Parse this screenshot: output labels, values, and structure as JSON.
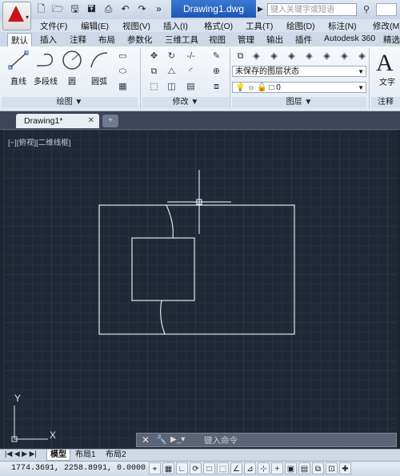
{
  "titlebar": {
    "doc_title": "Drawing1.dwg",
    "search_placeholder": "键入关键字或短语",
    "quick_access_icons": [
      "new-icon",
      "open-icon",
      "save-icon",
      "save-as-icon",
      "print-icon",
      "undo-icon",
      "redo-icon",
      "more-icon"
    ]
  },
  "menu": {
    "items": [
      "文件(F)",
      "编辑(E)",
      "视图(V)",
      "插入(I)",
      "格式(O)",
      "工具(T)",
      "绘图(D)",
      "标注(N)",
      "修改(M)"
    ]
  },
  "ribbon_tabs": {
    "items": [
      "默认",
      "插入",
      "注释",
      "布局",
      "参数化",
      "三维工具",
      "视图",
      "管理",
      "输出",
      "插件",
      "Autodesk 360",
      "精选"
    ],
    "active": "默认"
  },
  "ribbon": {
    "draw_tools": [
      "直线",
      "多段线",
      "圆",
      "圆弧"
    ],
    "draw_panel": "绘图 ▼",
    "modify_panel": "修改 ▼",
    "layer_panel": "图层 ▼",
    "annotation_panel": "注释",
    "layer_state": "未保存的图层状态",
    "current_layer": "0",
    "text_icon_glyph": "A",
    "text_label": "文字"
  },
  "file_tabs": {
    "active": "Drawing1*",
    "close": "✕"
  },
  "viewport": {
    "label": "[−][俯视][二维线框]",
    "ucs_y": "Y",
    "ucs_x": "X"
  },
  "command_line": {
    "placeholder": "键入命令",
    "close": "✕",
    "prompt_glyph": "▶_▾"
  },
  "layout_tabs": {
    "items": [
      "模型",
      "布局1",
      "布局2"
    ],
    "active": "模型",
    "nav": "|◀ ◀ ▶ ▶|"
  },
  "status": {
    "coordinates": "1774.3691, 2258.8991, 0.0000"
  },
  "colors": {
    "canvas_bg": "#202838",
    "line": "#e6e6e6",
    "title_active": "#1d56b4",
    "app_logo": "#c5161d"
  }
}
